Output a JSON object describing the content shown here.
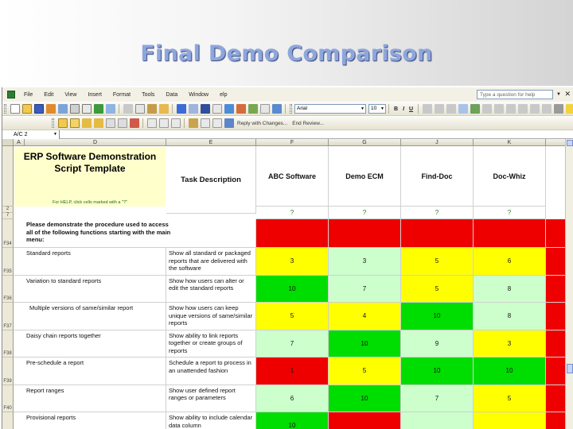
{
  "slide": {
    "title": "Final Demo Comparison"
  },
  "menu": {
    "items": [
      "File",
      "Edit",
      "View",
      "Insert",
      "Format",
      "Tools",
      "Data",
      "Window",
      "elp"
    ],
    "help_placeholder": "Type a question for help"
  },
  "toolbar": {
    "font_name": "Arial",
    "font_size": "10",
    "bold": "B",
    "italic": "I",
    "underline": "U",
    "reply_text": "Reply with Changes...",
    "end_review": "End Review..."
  },
  "formula_bar": {
    "cell_ref": "A/C 2"
  },
  "columns": [
    "A",
    "D",
    "E",
    "F",
    "G",
    "J",
    "K"
  ],
  "template_title": "ERP Software Demonstration Script Template",
  "help_note": "For HELP, click cells marked with a \"?\"",
  "task_header": "Task Description",
  "vendors": [
    "ABC Software",
    "Demo ECM",
    "Find-Doc",
    "Doc-Whiz"
  ],
  "qmarks": [
    "?",
    "?",
    "?",
    "?"
  ],
  "intro_text": "Please demonstrate the procedure used to access all of the following functions starting with the main menu:",
  "header_row_labels": [
    "2",
    "7"
  ],
  "rows": [
    {
      "id": "F35",
      "task": "Standard reports",
      "desc": "Show all standard or packaged reports that are delivered with the software",
      "scores": [
        "3",
        "3",
        "5",
        "6"
      ]
    },
    {
      "id": "F36",
      "task": "Variation to standard reports",
      "desc": "Show how users can alter or edit the standard reports",
      "scores": [
        "10",
        "7",
        "5",
        "8"
      ]
    },
    {
      "id": "F37",
      "task": "Multiple versions of same/similar report",
      "desc": "Show how users can keep unique versions of same/similar reports",
      "scores": [
        "5",
        "4",
        "10",
        "8"
      ]
    },
    {
      "id": "F38",
      "task": "Daisy chain reports together",
      "desc": "Show ability to link reports together or create groups of reports",
      "scores": [
        "7",
        "10",
        "9",
        "3"
      ]
    },
    {
      "id": "F39",
      "task": "Pre-schedule a report",
      "desc": "Schedule a report to process in an unattended fashion",
      "scores": [
        "1",
        "5",
        "10",
        "10"
      ]
    },
    {
      "id": "F40",
      "task": "Report ranges",
      "desc": "Show user defined report ranges or parameters",
      "scores": [
        "6",
        "10",
        "7",
        "5"
      ]
    },
    {
      "id": "F41",
      "task": "Provisional reports",
      "desc": "Show ability to include calendar data column",
      "scores": [
        "10",
        "",
        "",
        ""
      ]
    }
  ],
  "colors": {
    "red": "#ee0000",
    "yellow": "#ffff00",
    "green": "#00dd00",
    "light_green": "#ccffcc"
  }
}
